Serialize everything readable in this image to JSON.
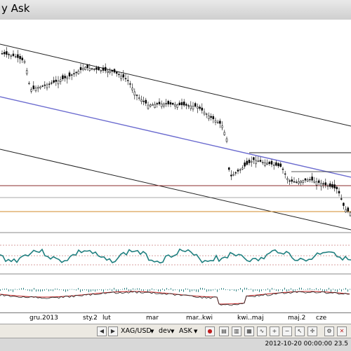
{
  "window": {
    "title": "y Ask"
  },
  "x_axis": {
    "labels": [
      "gru.2013",
      "sty.2",
      "lut",
      "mar",
      "mar..kwi",
      "kwi..maj",
      "maj.2",
      "cze"
    ]
  },
  "toolbar": {
    "symbol": "XAG/USD",
    "pair_dropdown": "dev",
    "price_dropdown": "ASK",
    "icons": [
      "prev-icon",
      "play-icon",
      "next-icon",
      "zoom-icon"
    ]
  },
  "status": {
    "datetime": "2012-10-20 00:00:00  23.5"
  },
  "colors": {
    "candles": "#000000",
    "trend_blue": "#6b6bcf",
    "level_red": "#8b2b2b",
    "level_orange": "#d08a2a",
    "oscillator": "#1f7f7f",
    "macd_red": "#c02020"
  }
}
